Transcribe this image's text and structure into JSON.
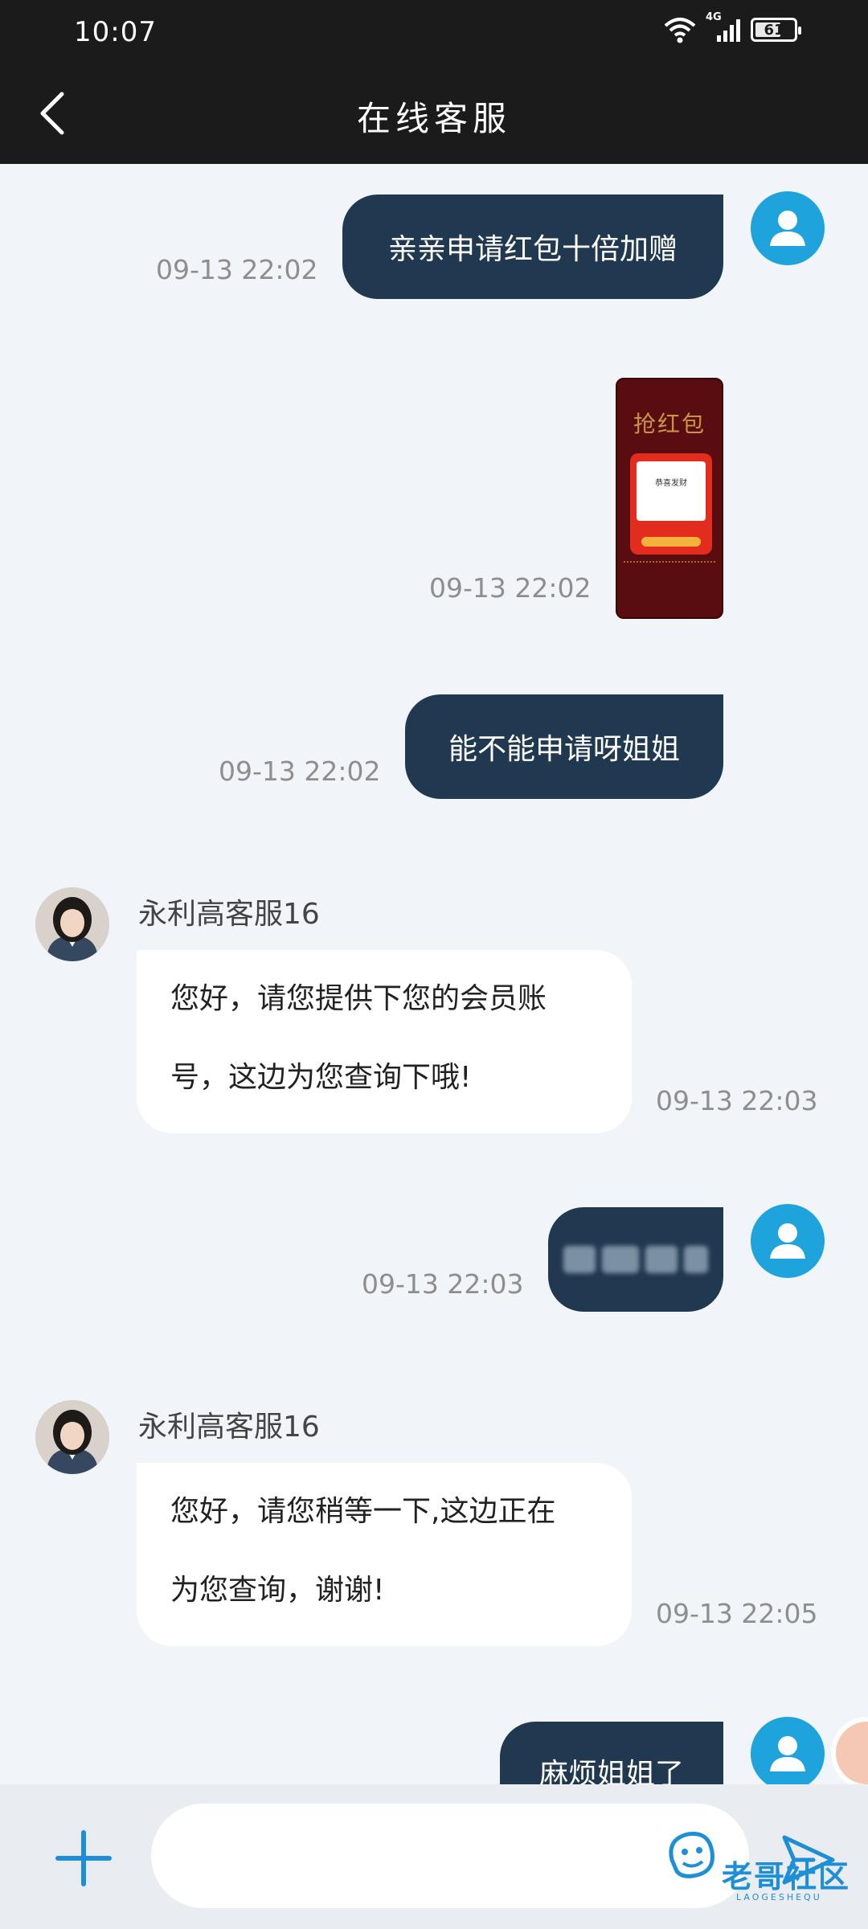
{
  "status_bar": {
    "time": "10:07",
    "network": "4G",
    "battery": "61"
  },
  "header": {
    "title": "在线客服"
  },
  "messages": {
    "m1": {
      "text": "亲亲申请红包十倍加赠",
      "time": "09-13 22:02"
    },
    "m2": {
      "time": "09-13 22:02",
      "image": {
        "title": "抢红包",
        "card_text": "恭喜发财"
      }
    },
    "m3": {
      "text": "能不能申请呀姐姐",
      "time": "09-13 22:02"
    },
    "m4": {
      "agent": "永利高客服16",
      "lines": [
        "您好，请您提供下您的会员账",
        "号，这边为您查询下哦!"
      ],
      "time": "09-13 22:03"
    },
    "m5": {
      "time": "09-13 22:03"
    },
    "m6": {
      "agent": "永利高客服16",
      "lines": [
        "您好，请您稍等一下,这边正在",
        "为您查询，谢谢!"
      ],
      "time": "09-13 22:05"
    },
    "m7": {
      "text": "麻烦姐姐了"
    }
  },
  "input": {
    "placeholder": ""
  },
  "watermark": {
    "text": "老哥社区",
    "sub": "LAOGESHEQU"
  },
  "colors": {
    "outgoing_bubble": "#213950",
    "user_avatar": "#1fa3dc",
    "header": "#1b1b1b",
    "background": "#f1f4f8"
  },
  "icons": [
    "back-arrow-icon",
    "wifi-icon",
    "signal-icon",
    "battery-icon",
    "user-icon",
    "plus-icon",
    "send-icon"
  ]
}
